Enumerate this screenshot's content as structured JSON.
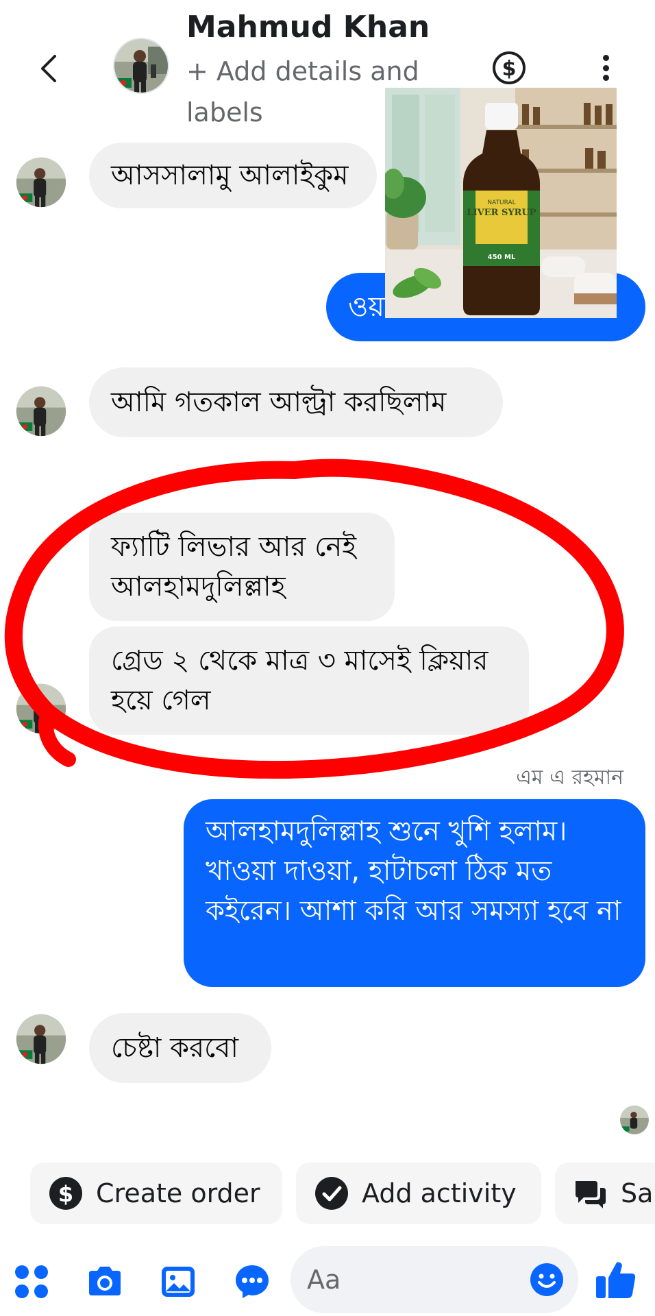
{
  "header": {
    "name": "Mahmud Khan",
    "subtitle": "+ Add details and labels"
  },
  "messages": [
    {
      "side": "in",
      "text": "আসসালামু আলাইকুম"
    },
    {
      "side": "out",
      "text": "ওয়া... ...ম"
    },
    {
      "side": "in",
      "text": "আমি গতকাল আল্ট্রা করছিলাম"
    },
    {
      "side": "in",
      "text": "ফ্যাটি লিভার আর নেই আলহামদুলিল্লাহ"
    },
    {
      "side": "in",
      "text": "গ্রেড ২ থেকে মাত্র ৩ মাসেই ক্লিয়ার হয়ে গেল"
    },
    {
      "side": "out",
      "text": "আলহামদুলিল্লাহ শুনে খুশি হলাম। খাওয়া দাওয়া, হাটাচলা ঠিক মত কইরেন। আশা করি আর সমস্যা হবে না"
    },
    {
      "side": "in",
      "text": "চেষ্টা করবো"
    }
  ],
  "sender_label": "এম এ রহমান",
  "product_image": {
    "label_line1": "NATURAL",
    "label_line2": "LIVER SYRUP",
    "label_volume": "450 ML"
  },
  "actions": [
    {
      "label": "Create order",
      "icon": "dollar-icon"
    },
    {
      "label": "Add activity",
      "icon": "check-circle-icon"
    },
    {
      "label": "Sa",
      "icon": "chat-bubbles-icon"
    }
  ],
  "composer": {
    "placeholder": "Aa"
  },
  "colors": {
    "accent": "#0866ff",
    "incoming_bubble": "#f0f0f0",
    "annotation": "#ff0000"
  }
}
